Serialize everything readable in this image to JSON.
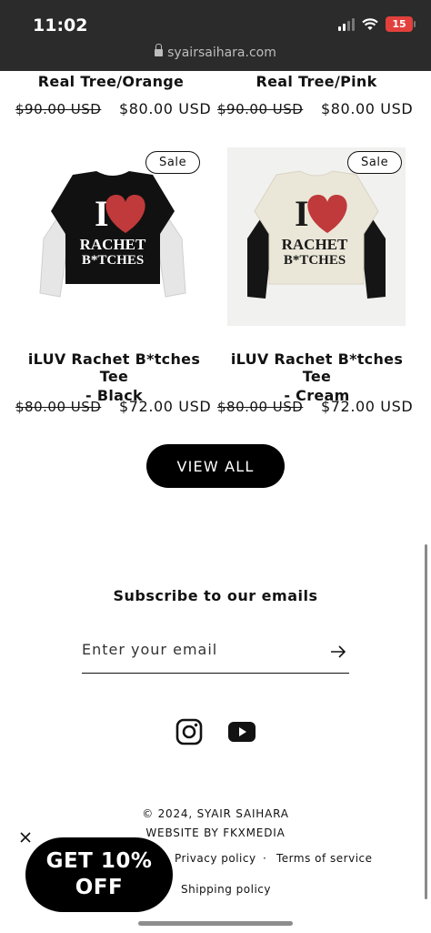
{
  "status_bar": {
    "time": "11:02",
    "battery": "15"
  },
  "browser": {
    "url": "syairsaihara.com"
  },
  "products_top": [
    {
      "title": "Real Tree/Orange",
      "old_price": "$90.00 USD",
      "new_price": "$80.00 USD"
    },
    {
      "title": "Real Tree/Pink",
      "old_price": "$90.00 USD",
      "new_price": "$80.00 USD"
    }
  ],
  "products": [
    {
      "badge": "Sale",
      "title_line1": "iLUV Rachet B*tches Tee",
      "title_line2": "- Black",
      "old_price": "$80.00 USD",
      "new_price": "$72.00 USD",
      "shirt_color": "#111111",
      "sleeve_color": "#e6e6e6",
      "print_color": "#ffffff",
      "print_line1": "I",
      "print_line2": "RACHET",
      "print_line3": "B*TCHES"
    },
    {
      "badge": "Sale",
      "title_line1": "iLUV Rachet B*tches Tee",
      "title_line2": "- Cream",
      "old_price": "$80.00 USD",
      "new_price": "$72.00 USD",
      "shirt_color": "#ebe7d8",
      "sleeve_color": "#151515",
      "print_color": "#1a1a1a",
      "print_line1": "I",
      "print_line2": "RACHET",
      "print_line3": "B*TCHES"
    }
  ],
  "view_all_label": "VIEW ALL",
  "newsletter": {
    "title": "Subscribe to our emails",
    "placeholder": "Enter your email"
  },
  "social": [
    "instagram-icon",
    "youtube-icon"
  ],
  "footer": {
    "copyright": "© 2024, SYAIR SAIHARA",
    "credit": "WEBSITE BY FKXMEDIA",
    "privacy": "Privacy policy",
    "separator": "·",
    "terms": "Terms of service",
    "shipping": "Shipping policy"
  },
  "popup": {
    "line1": "GET 10%",
    "line2": "OFF"
  },
  "colors": {
    "heart": "#c0393b",
    "text": "#121212",
    "statusbar": "#2b2b2b"
  }
}
